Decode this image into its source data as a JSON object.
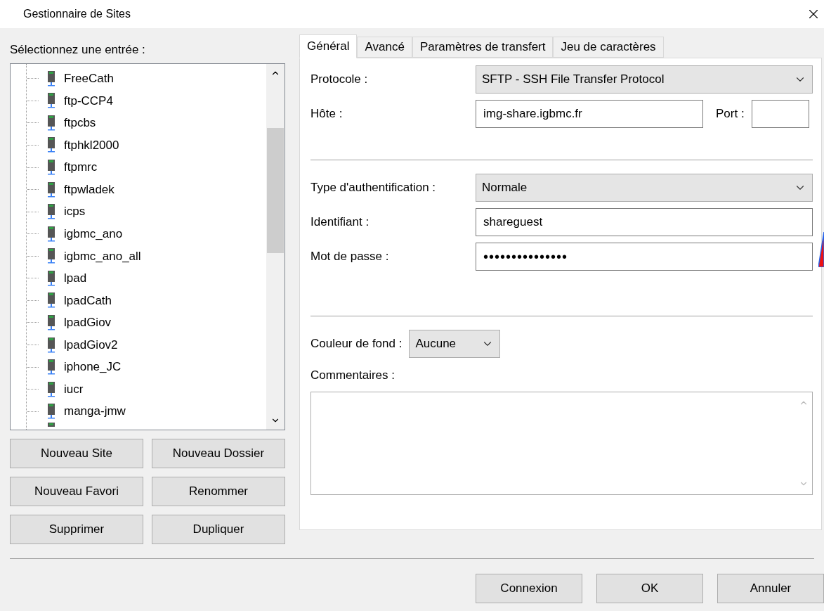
{
  "window": {
    "title": "Gestionnaire de Sites"
  },
  "site_tree": {
    "label": "Sélectionnez une entrée :",
    "items": [
      {
        "name": "FreeCath",
        "selected": false
      },
      {
        "name": "ftp-CCP4",
        "selected": false
      },
      {
        "name": "ftpcbs",
        "selected": false
      },
      {
        "name": "ftphkl2000",
        "selected": false
      },
      {
        "name": "ftpmrc",
        "selected": false
      },
      {
        "name": "ftpwladek",
        "selected": false
      },
      {
        "name": "icps",
        "selected": false
      },
      {
        "name": "igbmc_ano",
        "selected": false
      },
      {
        "name": "igbmc_ano_all",
        "selected": false
      },
      {
        "name": "lpad",
        "selected": false
      },
      {
        "name": "lpadCath",
        "selected": false
      },
      {
        "name": "lpadGiov",
        "selected": false
      },
      {
        "name": "lpadGiov2",
        "selected": false
      },
      {
        "name": "iphone_JC",
        "selected": false
      },
      {
        "name": "iucr",
        "selected": false
      },
      {
        "name": "manga-jmw",
        "selected": false
      }
    ]
  },
  "site_buttons": [
    "Nouveau Site",
    "Nouveau Dossier",
    "Nouveau Favori",
    "Renommer",
    "Supprimer",
    "Dupliquer"
  ],
  "tabs": [
    {
      "label": "Général",
      "selected": true
    },
    {
      "label": "Avancé",
      "selected": false
    },
    {
      "label": "Paramètres de transfert",
      "selected": false
    },
    {
      "label": "Jeu de caractères",
      "selected": false
    }
  ],
  "general": {
    "protocol": {
      "label": "Protocole :",
      "value": "SFTP - SSH File Transfer Protocol"
    },
    "host": {
      "label": "Hôte :",
      "value": "img-share.igbmc.fr"
    },
    "port": {
      "label": "Port :"
    },
    "auth_type": {
      "label": "Type d'authentification :",
      "value": "Normale"
    },
    "user": {
      "label": "Identifiant :",
      "value": "shareguest"
    },
    "password": {
      "label": "Mot de passe :",
      "value": "•••••••••••••••"
    },
    "background_color": {
      "label": "Couleur de fond :",
      "value": "Aucune"
    },
    "comments": {
      "label": "Commentaires :"
    }
  },
  "dialog_buttons": [
    "Connexion",
    "OK",
    "Annuler"
  ]
}
